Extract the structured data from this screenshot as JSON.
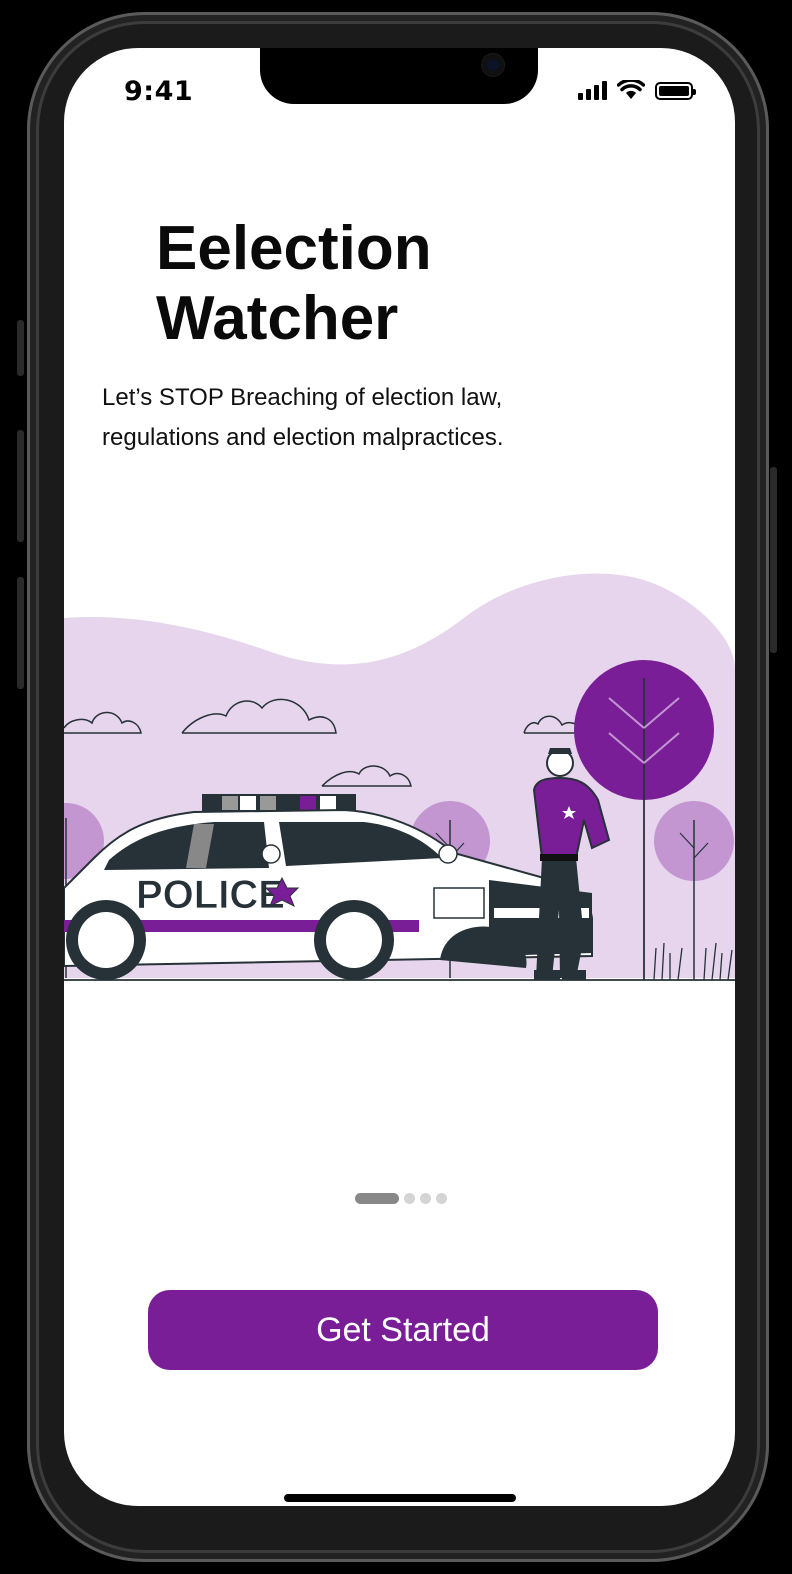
{
  "status_bar": {
    "time": "9:41"
  },
  "onboarding": {
    "title_line1": "Eelection",
    "title_line2": "Watcher",
    "description": "Let’s STOP Breaching of election law, regulations and election malpractices.",
    "illustration": {
      "car_label": "POLICE",
      "accent_color": "#791e96",
      "background_color": "#e6d5ec"
    },
    "pagination": {
      "total": 4,
      "active": 1
    },
    "cta_label": "Get Started"
  },
  "colors": {
    "primary": "#791e96",
    "blob": "#e6d5ec",
    "tree_light": "#c396d2",
    "dark": "#263238"
  }
}
